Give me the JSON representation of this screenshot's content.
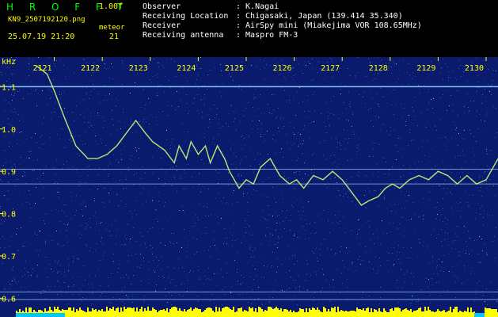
{
  "header": {
    "app_title": "H R O F F T",
    "version": "1.00f",
    "file_name": "KN9_2507192120.png",
    "mode_label": "meteor",
    "mode_value": "21",
    "datetime": "25.07.19 21:20",
    "info": [
      {
        "label": "Observer",
        "value": ": K.Nagai"
      },
      {
        "label": "Receiving Location",
        "value": ": Chigasaki, Japan (139.414 35.340)"
      },
      {
        "label": "Receiver",
        "value": ": AirSpy mini (Miakejima VOR 108.65MHz)"
      },
      {
        "label": "Receiving antenna",
        "value": ": Maspro FM-3"
      }
    ]
  },
  "colors": {
    "background": "#000000",
    "plot_background": "#0a1b6e",
    "noise": "#3a6ad6",
    "signal_trace": "#c8ff7a",
    "reference_line": "#8fd0ff",
    "tick_label": "#ffff00",
    "histogram": "#ffff00",
    "status_strip": "#00c8ff"
  },
  "chart_data": {
    "type": "line",
    "title": "",
    "xlabel": "",
    "ylabel": "kHz",
    "x_ticks": [
      "2121",
      "2122",
      "2123",
      "2124",
      "2125",
      "2126",
      "2127",
      "2128",
      "2129",
      "2130"
    ],
    "y_ticks": [
      "1.1",
      "1.0",
      "0.9",
      "0.8",
      "0.7",
      "0.6"
    ],
    "ylim": [
      0.58,
      1.17
    ],
    "grid": false,
    "reference_lines_khz": [
      1.1,
      0.905,
      0.87,
      0.615,
      0.597
    ],
    "series": [
      {
        "x": [
          2120.62,
          2120.85,
          2121.0,
          2121.2,
          2121.45,
          2121.7,
          2121.9,
          2122.1,
          2122.3,
          2122.5,
          2122.7,
          2122.9,
          2123.05,
          2123.3,
          2123.5,
          2123.6,
          2123.75,
          2123.85,
          2124.0,
          2124.15,
          2124.25,
          2124.4,
          2124.55,
          2124.65,
          2124.75,
          2124.85,
          2125.0,
          2125.15,
          2125.3,
          2125.5,
          2125.7,
          2125.9,
          2126.05,
          2126.2,
          2126.4,
          2126.6,
          2126.8,
          2127.0,
          2127.2,
          2127.4,
          2127.55,
          2127.75,
          2127.9,
          2128.05,
          2128.2,
          2128.4,
          2128.6,
          2128.8,
          2129.0,
          2129.2,
          2129.4,
          2129.6,
          2129.8,
          2130.0,
          2130.2,
          2130.3
        ],
        "values": [
          1.15,
          1.13,
          1.09,
          1.03,
          0.96,
          0.93,
          0.93,
          0.94,
          0.96,
          0.99,
          1.02,
          0.99,
          0.97,
          0.95,
          0.92,
          0.96,
          0.93,
          0.97,
          0.94,
          0.96,
          0.92,
          0.96,
          0.93,
          0.9,
          0.88,
          0.86,
          0.88,
          0.87,
          0.91,
          0.93,
          0.89,
          0.87,
          0.88,
          0.86,
          0.89,
          0.88,
          0.9,
          0.88,
          0.85,
          0.82,
          0.83,
          0.84,
          0.86,
          0.87,
          0.86,
          0.88,
          0.89,
          0.88,
          0.9,
          0.89,
          0.87,
          0.89,
          0.87,
          0.88,
          0.92,
          0.94
        ]
      }
    ]
  }
}
